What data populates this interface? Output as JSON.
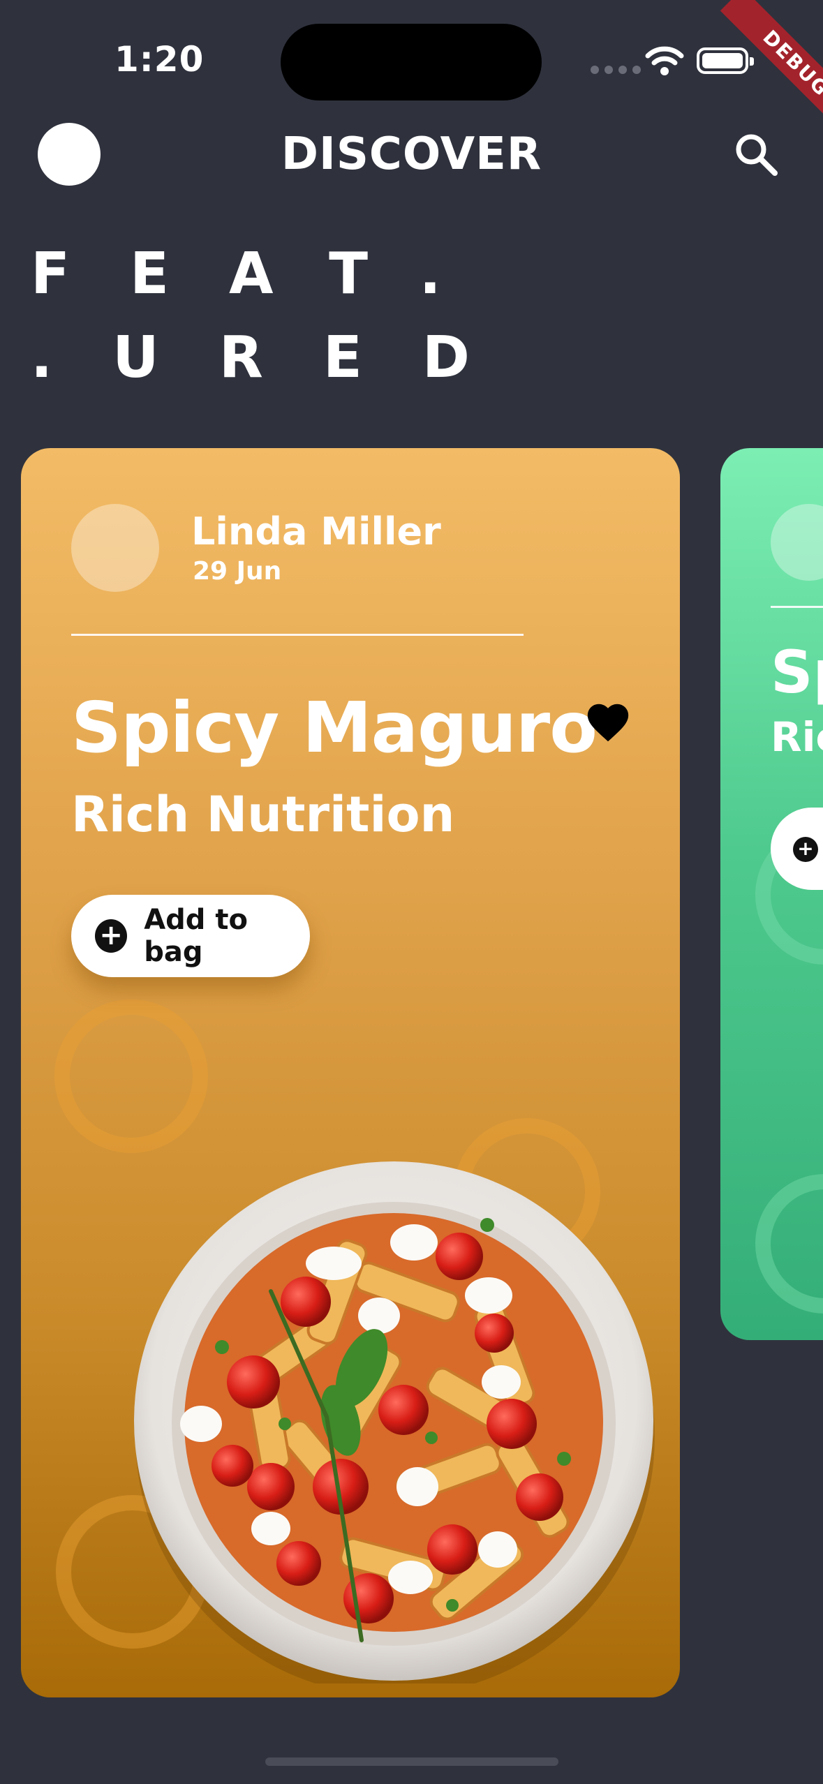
{
  "status_bar": {
    "time": "1:20",
    "debug_label": "DEBUG"
  },
  "header": {
    "title": "DISCOVER",
    "search_icon": "search-icon"
  },
  "featured": {
    "line1": "FEAT.",
    "line2": ".URED"
  },
  "cards": [
    {
      "author_name": "Linda Miller",
      "date": "29 Jun",
      "title": "Spicy Maguro",
      "subtitle": "Rich Nutrition",
      "button_label": "Add to bag",
      "favorite_icon": "heart-icon",
      "color": "#f3bb66"
    },
    {
      "title": "Sp",
      "subtitle": "Ric",
      "color": "#7ceeb3"
    }
  ],
  "colors": {
    "background": "#2f323d",
    "card_orange": "#e0a24a",
    "card_green": "#4fca8e",
    "debug_banner": "#a3232c"
  }
}
